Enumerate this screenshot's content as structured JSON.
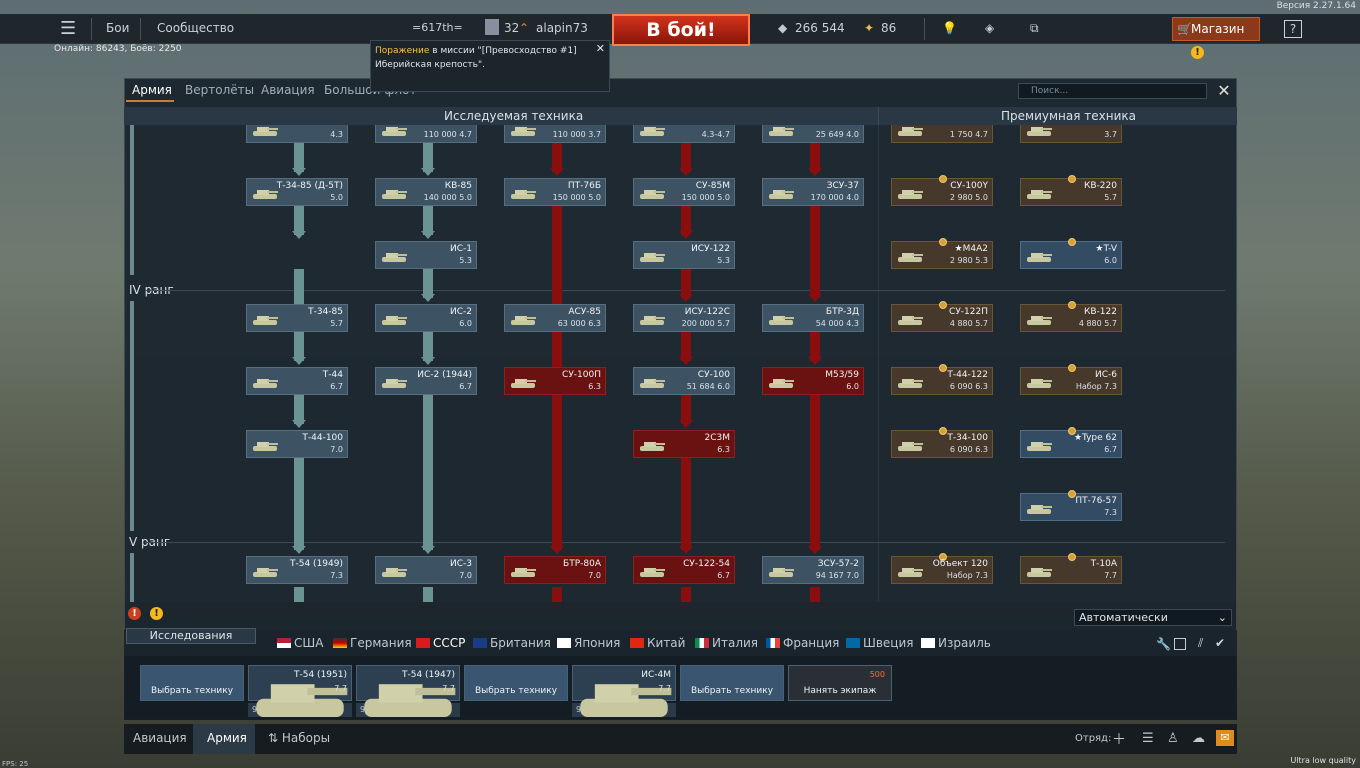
{
  "top": {
    "version": "Версия 2.27.1.64",
    "online": "Онлайн: 86243, Боёв: 2250",
    "menu_battles": "Бои",
    "menu_community": "Сообщество",
    "squadron": "=617th=",
    "level": "32",
    "username": "alapin73",
    "battle_button": "В бой!",
    "silver_lions": "266 544",
    "golden_eagles": "86",
    "shop_label": "Магазин"
  },
  "notification": {
    "result": "Поражение",
    "text_mid": "в миссии \"[Превосходство #1]",
    "text_line2": "Иберийская крепость\"."
  },
  "tabs": [
    "Армия",
    "Вертолёты",
    "Авиация",
    "Большой флот"
  ],
  "search_placeholder": "Поиск...",
  "headers": {
    "researchable": "Исследуемая техника",
    "premium": "Премиумная техника"
  },
  "ranks": {
    "iv": "IV ранг",
    "v": "V ранг"
  },
  "vehicles": [
    {
      "id": "c1r0",
      "name": "Т-34-85 (Д-5Т)",
      "br": "5.0"
    },
    {
      "id": "c2r0",
      "name": "КВ-85",
      "cost": "140 000",
      "br": "5.0"
    },
    {
      "id": "c3r0",
      "name": "ПТ-76Б",
      "cost": "150 000",
      "br": "5.0"
    },
    {
      "id": "c4r0",
      "name": "СУ-85М",
      "cost": "150 000",
      "br": "5.0"
    },
    {
      "id": "c5r0",
      "name": "ЗСУ-37",
      "cost": "170 000",
      "br": "4.0"
    },
    {
      "id": "c2r1",
      "name": "ИС-1",
      "br": "5.3"
    },
    {
      "id": "c4r1",
      "name": "ИСУ-122",
      "br": "5.3"
    },
    {
      "id": "c1r2",
      "name": "Т-34-85",
      "br": "5.7"
    },
    {
      "id": "c2r2",
      "name": "ИС-2",
      "br": "6.0"
    },
    {
      "id": "c3r2",
      "name": "АСУ-85",
      "cost": "63 000",
      "br": "6.3"
    },
    {
      "id": "c4r2",
      "name": "ИСУ-122С",
      "cost": "200 000",
      "br": "5.7"
    },
    {
      "id": "c5r2",
      "name": "БТР-3Д",
      "cost": "54 000",
      "br": "4.3"
    },
    {
      "id": "c1r3",
      "name": "Т-44",
      "br": "6.7"
    },
    {
      "id": "c2r3",
      "name": "ИС-2 (1944)",
      "br": "6.7"
    },
    {
      "id": "c3r3",
      "name": "СУ-100П",
      "br": "6.3"
    },
    {
      "id": "c4r3",
      "name": "СУ-100",
      "cost": "51 684",
      "br": "6.0"
    },
    {
      "id": "c5r3",
      "name": "M53/59",
      "br": "6.0"
    },
    {
      "id": "c1r4",
      "name": "Т-44-100",
      "br": "7.0"
    },
    {
      "id": "c4r4",
      "name": "2С3М",
      "br": "6.3"
    },
    {
      "id": "c1r5",
      "name": "Т-54 (1949)",
      "br": "7.3"
    },
    {
      "id": "c2r5",
      "name": "ИС-3",
      "br": "7.0"
    },
    {
      "id": "c3r5",
      "name": "БТР-80А",
      "br": "7.0"
    },
    {
      "id": "c4r5",
      "name": "СУ-122-54",
      "br": "6.7"
    },
    {
      "id": "c5r5",
      "name": "ЗСУ-57-2",
      "cost": "94 167",
      "br": "7.0"
    }
  ],
  "top_partial": [
    {
      "cost": "",
      "br": "4.3"
    },
    {
      "cost": "110 000",
      "br": "4.7"
    },
    {
      "cost": "110 000",
      "br": "3.7"
    },
    {
      "cost": "",
      "br": "4.3-4.7"
    },
    {
      "cost": "25 649",
      "br": "4.0"
    },
    {
      "cost": "1 750",
      "br": "4.7"
    },
    {
      "cost": "",
      "br": "3.7"
    }
  ],
  "premium": [
    {
      "name": "СУ-100Y",
      "cost": "2 980",
      "br": "5.0"
    },
    {
      "name": "КВ-220",
      "cost": "",
      "br": "5.7"
    },
    {
      "name": "★M4A2",
      "cost": "2 980",
      "br": "5.3"
    },
    {
      "name": "★T-V",
      "cost": "",
      "br": "6.0"
    },
    {
      "name": "СУ-122П",
      "cost": "4 880",
      "br": "5.7"
    },
    {
      "name": "КВ-122",
      "cost": "4 880",
      "br": "5.7"
    },
    {
      "name": "Т-44-122",
      "cost": "6 090",
      "br": "6.3"
    },
    {
      "name": "ИС-6",
      "cost": "Набор",
      "br": "7.3"
    },
    {
      "name": "Т-34-100",
      "cost": "6 090",
      "br": "6.3"
    },
    {
      "name": "★Type 62",
      "cost": "",
      "br": "6.7"
    },
    {
      "name": "ПТ-76-57",
      "cost": "",
      "br": "7.3"
    },
    {
      "name": "Объект 120",
      "cost": "Набор",
      "br": "7.3"
    },
    {
      "name": "Т-10А",
      "cost": "",
      "br": "7.7"
    }
  ],
  "research_label": "Исследования",
  "auto_label": "Автоматически",
  "nations": [
    "США",
    "Германия",
    "СССР",
    "Британия",
    "Япония",
    "Китай",
    "Италия",
    "Франция",
    "Швеция",
    "Израиль"
  ],
  "crew": [
    {
      "type": "empty",
      "text": "Выбрать технику"
    },
    {
      "type": "tank",
      "name": "Т-54 (1951)",
      "br": "7.7",
      "foot": "98"
    },
    {
      "type": "tank",
      "name": "Т-54 (1947)",
      "br": "7.7",
      "foot": "92"
    },
    {
      "type": "empty",
      "text": "Выбрать технику"
    },
    {
      "type": "tank",
      "name": "ИС-4М",
      "br": "7.7",
      "foot": "94"
    },
    {
      "type": "empty",
      "text": "Выбрать технику"
    },
    {
      "type": "hire",
      "text": "Нанять экипаж",
      "cost": "500"
    }
  ],
  "bottom": {
    "aviation": "Авиация",
    "army": "Армия",
    "presets": "Наборы",
    "squad": "Отряд:",
    "fps": "FPS: 25",
    "quality": "Ultra low quality"
  }
}
